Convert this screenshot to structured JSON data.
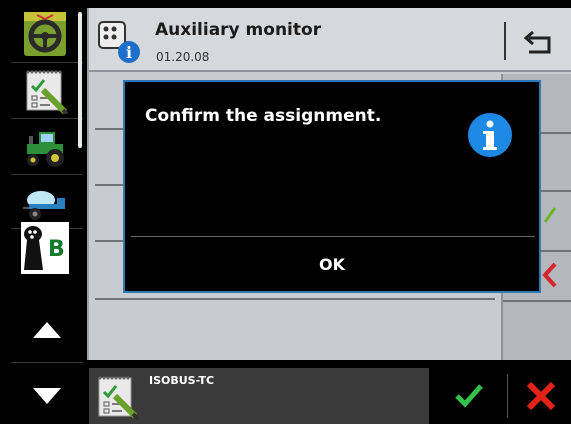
{
  "header": {
    "title": "Auxiliary monitor",
    "version": "01.20.08",
    "icons": {
      "app": "auxiliary-monitor-info-icon",
      "back": "back-arrow-icon"
    }
  },
  "dialog": {
    "message": "Confirm the assignment.",
    "ok_label": "OK",
    "icon": "info-icon"
  },
  "sidebar": {
    "items": [
      {
        "name": "terminal-home-icon"
      },
      {
        "name": "task-notepad-icon"
      },
      {
        "name": "tractor-icon"
      },
      {
        "name": "sprayer-icon"
      },
      {
        "name": "joystick-b-icon",
        "letter": "B"
      }
    ],
    "nav": {
      "up": "scroll-up-icon",
      "down": "scroll-down-icon"
    }
  },
  "bottom": {
    "app_label": "ISOBUS-TC",
    "confirm": "check-icon",
    "cancel": "cross-icon"
  },
  "colors": {
    "accent": "#2e7ab5",
    "info": "#1e88e5",
    "confirm": "#34c04a",
    "cancel": "#e2231a"
  }
}
